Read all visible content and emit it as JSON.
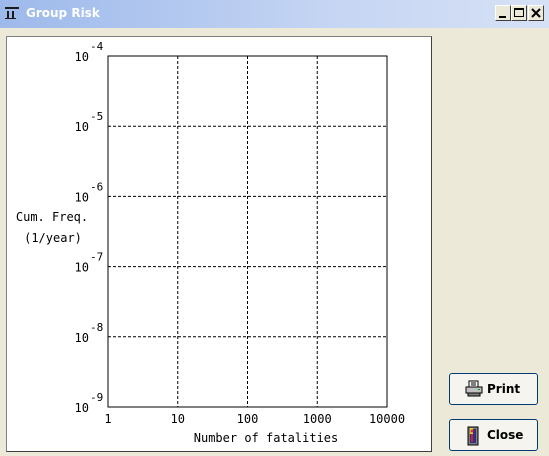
{
  "window": {
    "title": "Group Risk",
    "controls": [
      "minimize",
      "maximize",
      "close"
    ],
    "icon": "app-icon"
  },
  "chart_data": {
    "type": "line",
    "title": "",
    "xlabel": "Number of fatalities",
    "ylabel_lines": [
      "Cum. Freq.",
      "(1/year)"
    ],
    "x_scale": "log",
    "y_scale": "log",
    "x_ticks": [
      1,
      10,
      100,
      1000,
      10000
    ],
    "x_tick_labels": [
      "1",
      "10",
      "100",
      "1000",
      "10000"
    ],
    "y_ticks": [
      1e-09,
      1e-08,
      1e-07,
      1e-06,
      1e-05,
      0.0001
    ],
    "y_tick_base": "10",
    "y_tick_exponents": [
      "-9",
      "-8",
      "-7",
      "-6",
      "-5",
      "-4"
    ],
    "xlim": [
      1,
      10000
    ],
    "ylim": [
      1e-09,
      0.0001
    ],
    "grid": true,
    "series": []
  },
  "buttons": {
    "print_label": "Print",
    "close_label": "Close"
  },
  "icons": {
    "print": "printer-icon",
    "close": "exit-door-icon"
  }
}
